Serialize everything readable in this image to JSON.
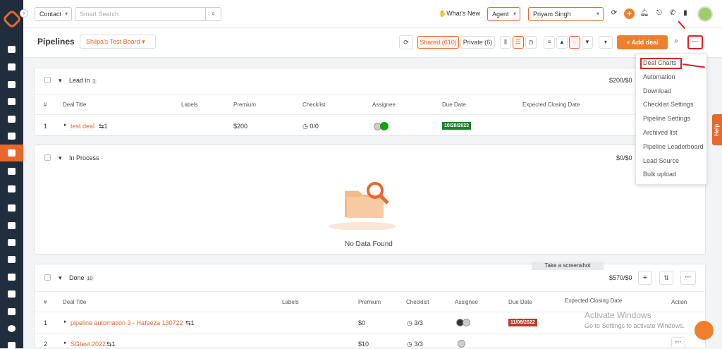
{
  "topbar": {
    "contact_select": "Contact",
    "search_placeholder": "Smart Search",
    "whats_new": "What's New",
    "agent_select": "Agent",
    "user_select": "Priyam Singh"
  },
  "pipeline_header": {
    "title": "Pipelines",
    "board": "Shilpa's Test Board",
    "shared": "Shared (610)",
    "private": "Private (6)",
    "add_deal": "+ Add deal",
    "more": "···"
  },
  "menu": {
    "items": [
      "Deal Charts",
      "Automation",
      "Download",
      "Checklist Settings",
      "Pipeline Settings",
      "Archived list",
      "Pipeline Leaderboard",
      "Lead Source",
      "Bulk upload"
    ]
  },
  "lead_in": {
    "name": "Lead in",
    "count": "1",
    "total": "$200/$0",
    "headers": [
      "#",
      "Deal Title",
      "Labels",
      "Premium",
      "Checklist",
      "Assignee",
      "Due Date",
      "Expected Closing Date"
    ],
    "rows": [
      {
        "num": "1",
        "title": "test deal",
        "sub": "1",
        "premium": "$200",
        "checklist": "0/0",
        "due": "10/28/2023"
      }
    ]
  },
  "in_process": {
    "name": "In Process",
    "count": "-",
    "total": "$0/$0",
    "empty": "No Data Found"
  },
  "done": {
    "name": "Done",
    "count": "10",
    "total": "$570/$0",
    "headers": [
      "#",
      "Deal Title",
      "Labels",
      "Premium",
      "Checklist",
      "Assignee",
      "Due Date",
      "Expected Closing Date",
      "Action"
    ],
    "rows": [
      {
        "num": "1",
        "title": "pipeline automation 3 - Hafeeza 130722",
        "sub": "1",
        "premium": "$0",
        "checklist": "3/3",
        "due": "11/08/2022"
      },
      {
        "num": "2",
        "title": "SGtest 2022",
        "sub": "1",
        "premium": "$10",
        "checklist": "3/3",
        "due": ""
      }
    ]
  },
  "help": "Help",
  "tooltip": "Take a screenshot",
  "activate_title": "Activate Windows",
  "activate_sub": "Go to Settings to activate Windows.",
  "colors": {
    "accent": "#e8672c",
    "sidebar": "#1f2d3d",
    "highlight": "#e02020"
  }
}
